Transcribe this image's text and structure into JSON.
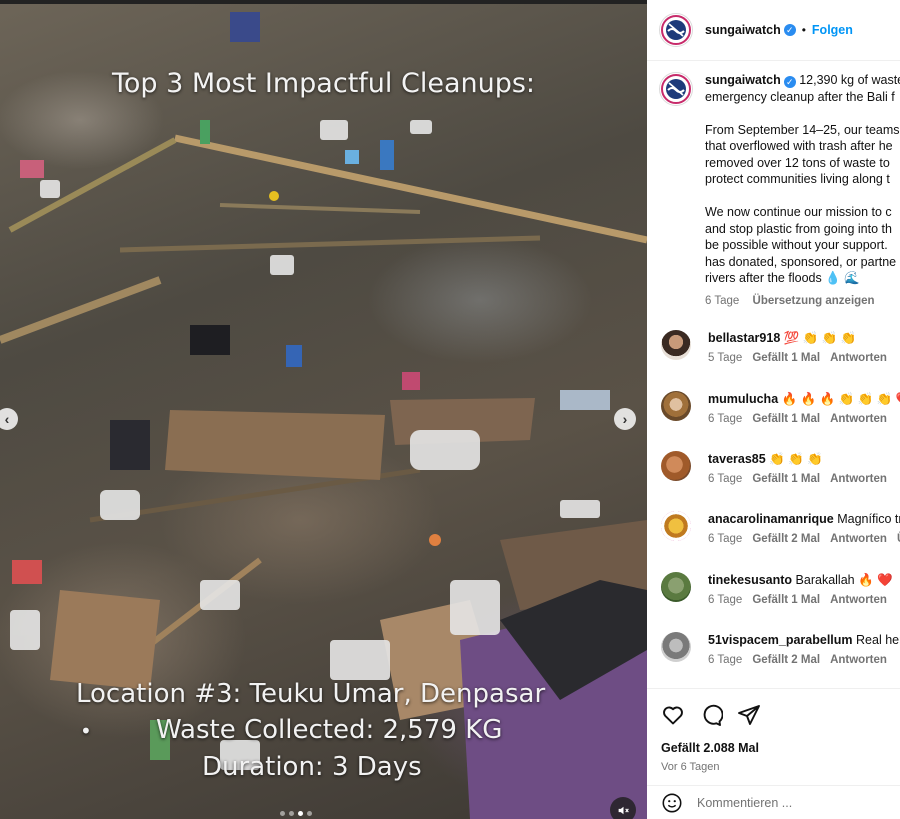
{
  "media": {
    "title": "Top 3 Most Impactful Cleanups:",
    "location_line": "Location #3: Teuku Umar, Denpasar",
    "waste_line": "Waste Collected: 2,579 KG",
    "duration_line": "Duration: 3 Days",
    "bullet": "•"
  },
  "post": {
    "username": "sungaiwatch",
    "follow_label": "Folgen",
    "separator": "•",
    "caption_lines_1": [
      "12,390 kg of waste",
      "emergency cleanup after the Bali f"
    ],
    "caption_para_2": [
      "From September 14–25, our teams",
      "that overflowed with trash after he",
      "removed over 12 tons of waste to",
      "protect communities living along t"
    ],
    "caption_para_3": [
      "We now continue our mission to c",
      "and stop plastic from going into th",
      "be possible without your support.",
      "has donated, sponsored, or partne",
      "rivers after the floods 💧 🌊"
    ],
    "time": "6 Tage",
    "translate_label": "Übersetzung anzeigen"
  },
  "comments": [
    {
      "user": "bellastar918",
      "text": "💯 👏 👏 👏",
      "time": "5 Tage",
      "likes": "Gefällt 1 Mal",
      "reply": "Antworten",
      "extra": ""
    },
    {
      "user": "mumulucha",
      "text": "🔥 🔥 🔥 👏 👏 👏 ❤️",
      "time": "6 Tage",
      "likes": "Gefällt 1 Mal",
      "reply": "Antworten",
      "extra": ""
    },
    {
      "user": "taveras85",
      "text": "👏 👏 👏",
      "time": "6 Tage",
      "likes": "Gefällt 1 Mal",
      "reply": "Antworten",
      "extra": ""
    },
    {
      "user": "anacarolinamanrique",
      "text": "Magnífico tr",
      "time": "6 Tage",
      "likes": "Gefällt 2 Mal",
      "reply": "Antworten",
      "extra": "Üb"
    },
    {
      "user": "tinekesusanto",
      "text": "Barakallah 🔥 ❤️",
      "time": "6 Tage",
      "likes": "Gefällt 1 Mal",
      "reply": "Antworten",
      "extra": ""
    },
    {
      "user": "51vispacem_parabellum",
      "text": "Real hero",
      "time": "6 Tage",
      "likes": "Gefällt 2 Mal",
      "reply": "Antworten",
      "extra": ""
    }
  ],
  "footer": {
    "likes": "Gefällt 2.088 Mal",
    "ago": "Vor 6 Tagen",
    "comment_placeholder": "Kommentieren ..."
  },
  "icons": {
    "like": "heart-icon",
    "comment": "comment-bubble-icon",
    "share": "send-icon",
    "emoji": "emoji-icon",
    "mute": "speaker-muted-icon",
    "verified": "verified-badge-icon"
  },
  "colors": {
    "link_blue": "#0095f6",
    "verified_blue": "#2a8cf0",
    "muted_text": "#737373"
  }
}
